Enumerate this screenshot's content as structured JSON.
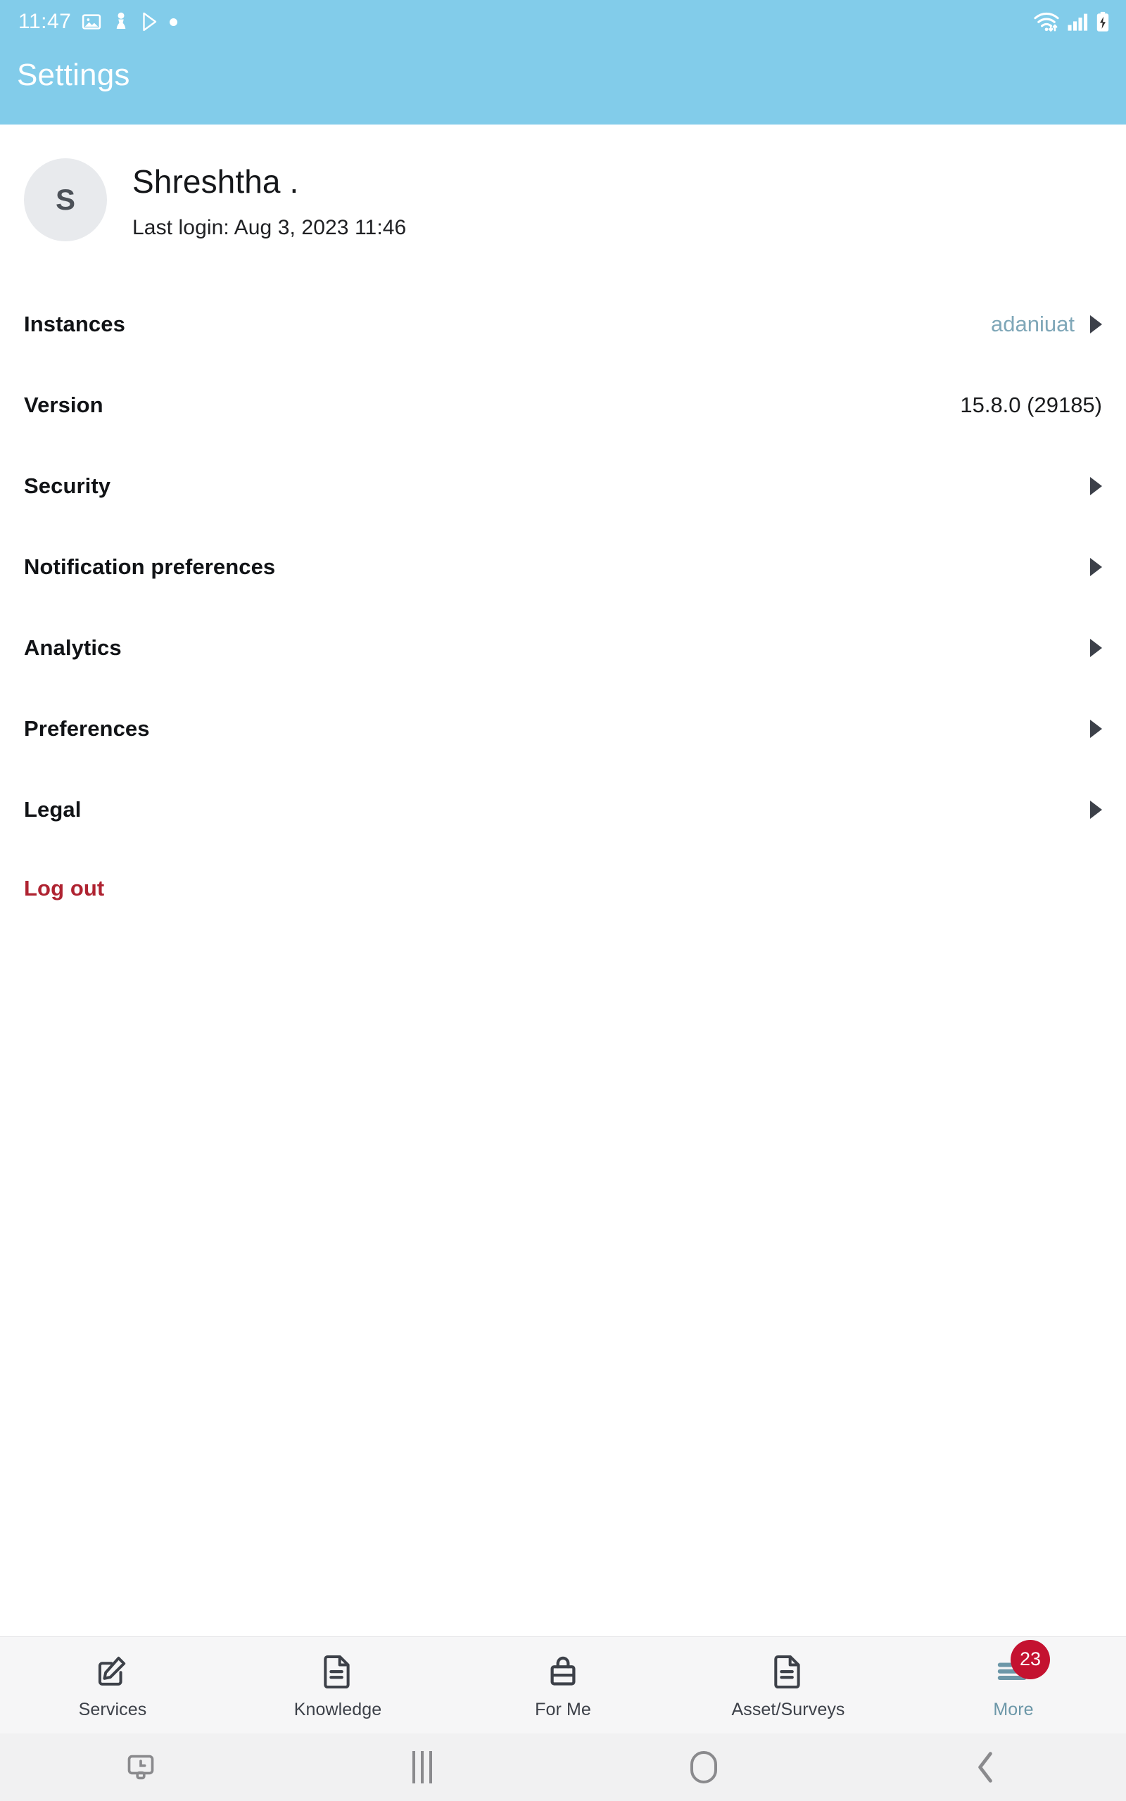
{
  "status_bar": {
    "time": "11:47",
    "left_icons": [
      "image-icon",
      "pawn-icon",
      "play-store-icon",
      "dot-icon"
    ],
    "right_icons": [
      "wifi-icon",
      "cellular-signal-icon",
      "battery-charging-icon"
    ],
    "background_color": "#82CCEA"
  },
  "app_bar": {
    "title": "Settings",
    "background_color": "#82CCEA",
    "title_color": "#FFFFFF"
  },
  "profile": {
    "avatar_initial": "S",
    "name": "Shreshtha .",
    "last_login": "Last login: Aug 3, 2023 11:46"
  },
  "settings_rows": [
    {
      "label": "Instances",
      "value": "adaniuat",
      "value_is_link": true,
      "has_caret": true
    },
    {
      "label": "Version",
      "value": "15.8.0 (29185)",
      "value_is_link": false,
      "has_caret": false
    },
    {
      "label": "Security",
      "value": "",
      "value_is_link": false,
      "has_caret": true
    },
    {
      "label": "Notification preferences",
      "value": "",
      "value_is_link": false,
      "has_caret": true
    },
    {
      "label": "Analytics",
      "value": "",
      "value_is_link": false,
      "has_caret": true
    },
    {
      "label": "Preferences",
      "value": "",
      "value_is_link": false,
      "has_caret": true
    },
    {
      "label": "Legal",
      "value": "",
      "value_is_link": false,
      "has_caret": true
    }
  ],
  "logout": {
    "label": "Log out",
    "color": "#AF2331"
  },
  "bottom_tabs": [
    {
      "label": "Services",
      "icon": "edit-square-icon",
      "active": false,
      "badge": ""
    },
    {
      "label": "Knowledge",
      "icon": "document-icon",
      "active": false,
      "badge": ""
    },
    {
      "label": "For Me",
      "icon": "briefcase-icon",
      "active": false,
      "badge": ""
    },
    {
      "label": "Asset/Surveys",
      "icon": "document-icon",
      "active": false,
      "badge": ""
    },
    {
      "label": "More",
      "icon": "hamburger-icon",
      "active": true,
      "badge": "23"
    }
  ],
  "system_nav": {
    "buttons": [
      "screen-clock-icon",
      "recents-icon",
      "home-icon",
      "back-icon"
    ]
  },
  "colors": {
    "accent_blue": "#82CCEA",
    "link_blue": "#7FA7B8",
    "logout_red": "#AF2331",
    "badge_red": "#C41230",
    "tabbar_bg": "#F6F6F7"
  }
}
